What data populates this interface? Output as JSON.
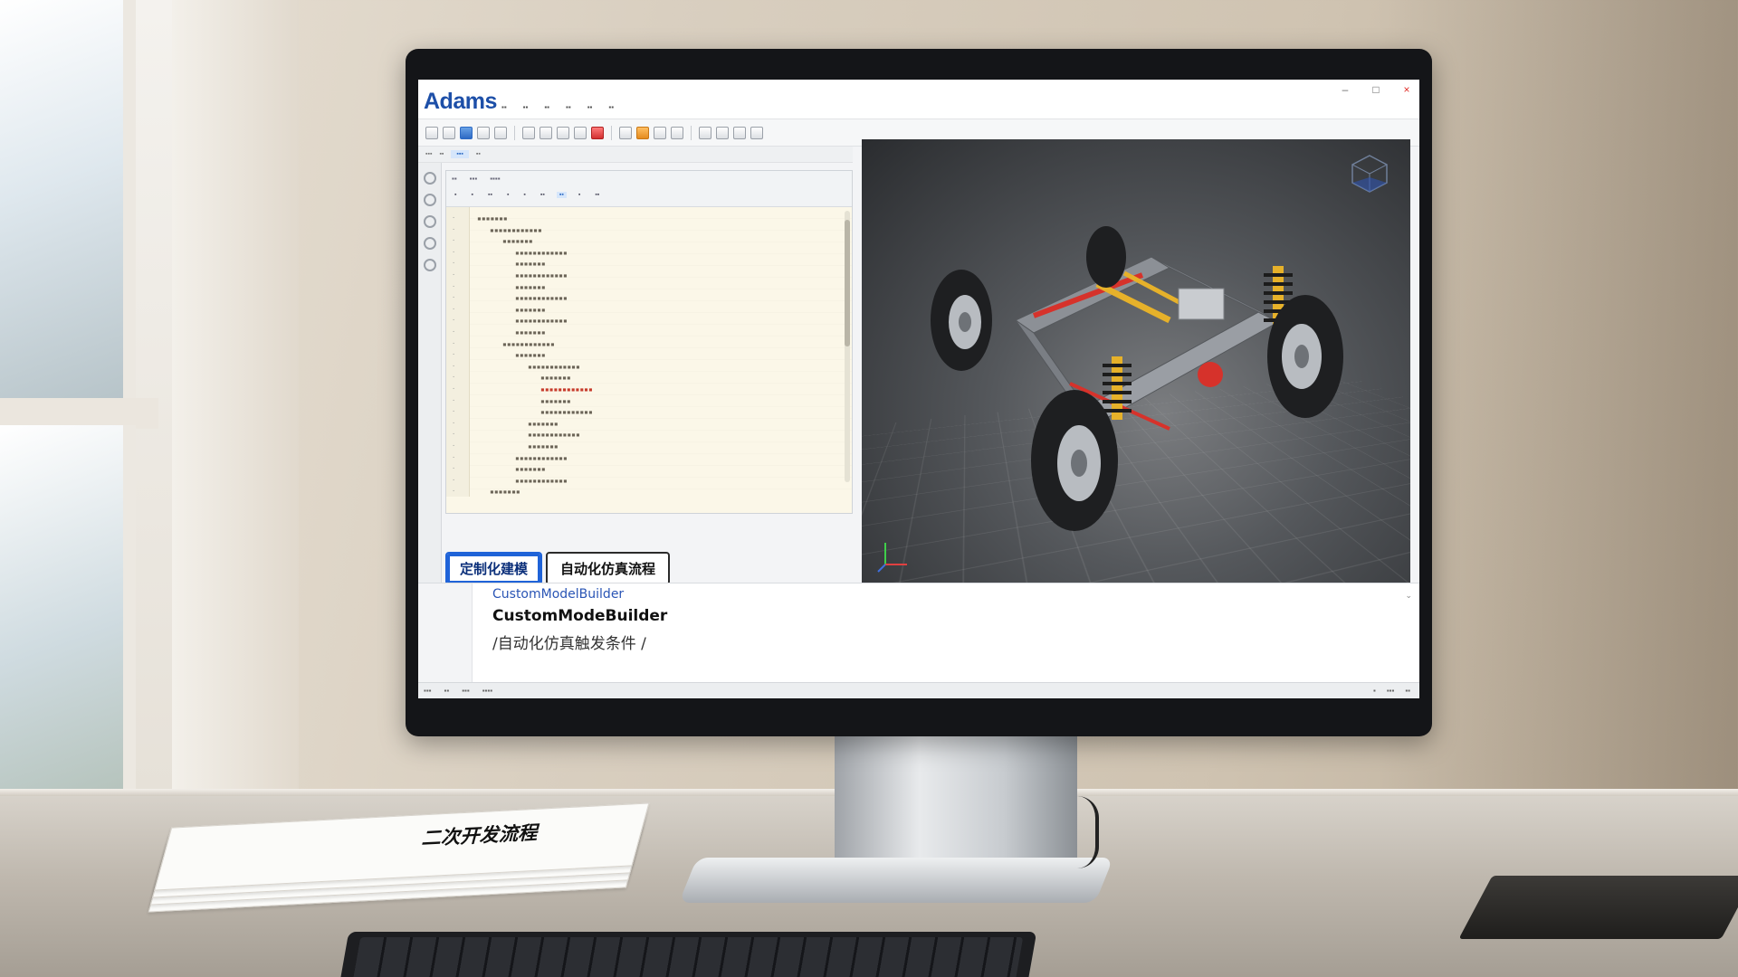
{
  "document": {
    "title": "二次开发流程"
  },
  "app": {
    "logo": "Adams",
    "window_controls": [
      "–",
      "□",
      "×"
    ]
  },
  "feature_tabs": [
    {
      "label": "定制化建模",
      "active": true
    },
    {
      "label": "自动化仿真流程",
      "active": false
    }
  ],
  "console": {
    "line1": "CustomModelBuilder",
    "line2": "CustomModeBuilder",
    "line3": "/自动化仿真触发条件 /"
  },
  "icons": {
    "toolbar": [
      "file-icon",
      "open-icon",
      "save-icon",
      "undo-icon",
      "redo-icon",
      "select-icon",
      "part-icon",
      "joint-icon",
      "force-icon",
      "spring-icon",
      "measure-icon",
      "simulate-icon",
      "plot-icon",
      "settings-icon"
    ],
    "side_tools": [
      "select-icon",
      "rotate-icon",
      "zoom-icon",
      "pan-icon",
      "render-icon"
    ]
  },
  "colors": {
    "brand": "#1d4fa8",
    "active_tab": "#1f63d8",
    "code_highlight": "#c73b2b",
    "spring": "#e6b12a",
    "frame_red": "#d6322b"
  }
}
